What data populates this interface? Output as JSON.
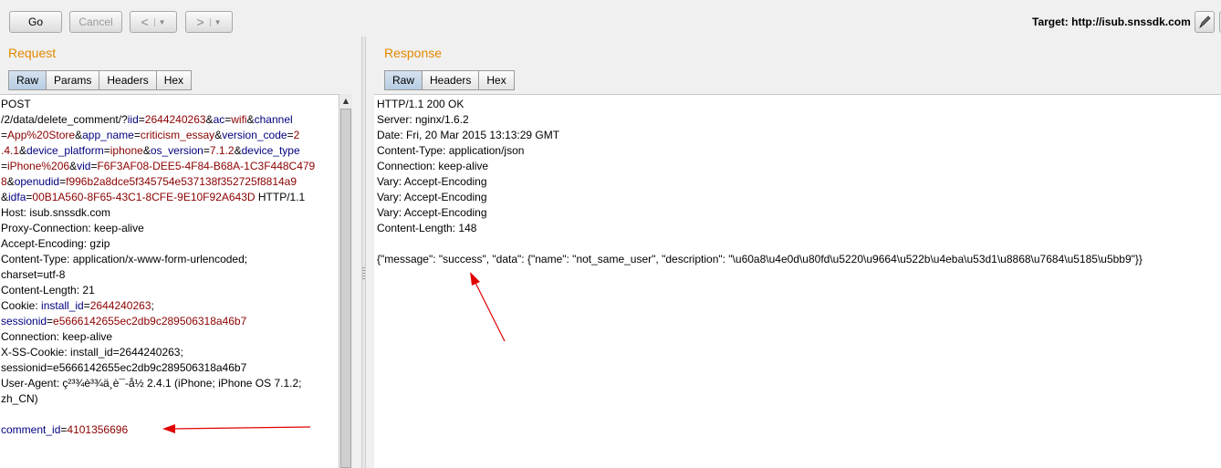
{
  "toolbar": {
    "go_label": "Go",
    "cancel_label": "Cancel",
    "back_glyph": "<",
    "forward_glyph": ">",
    "dropdown_glyph": "▼",
    "target_label": "Target: http://isub.snssdk.com"
  },
  "request": {
    "title": "Request",
    "tabs": [
      "Raw",
      "Params",
      "Headers",
      "Hex"
    ],
    "active_tab": "Raw",
    "lines": [
      [
        [
          "t",
          "POST"
        ]
      ],
      [
        [
          "t",
          "/2/data/delete_comment/?"
        ],
        [
          "k",
          "iid"
        ],
        [
          "t",
          "="
        ],
        [
          "v",
          "2644240263"
        ],
        [
          "t",
          "&"
        ],
        [
          "k",
          "ac"
        ],
        [
          "t",
          "="
        ],
        [
          "v",
          "wifi"
        ],
        [
          "t",
          "&"
        ],
        [
          "k",
          "channel"
        ]
      ],
      [
        [
          "t",
          "="
        ],
        [
          "v",
          "App%20Store"
        ],
        [
          "t",
          "&"
        ],
        [
          "k",
          "app_name"
        ],
        [
          "t",
          "="
        ],
        [
          "v",
          "criticism_essay"
        ],
        [
          "t",
          "&"
        ],
        [
          "k",
          "version_code"
        ],
        [
          "t",
          "="
        ],
        [
          "v",
          "2"
        ]
      ],
      [
        [
          "v",
          ".4.1"
        ],
        [
          "t",
          "&"
        ],
        [
          "k",
          "device_platform"
        ],
        [
          "t",
          "="
        ],
        [
          "v",
          "iphone"
        ],
        [
          "t",
          "&"
        ],
        [
          "k",
          "os_version"
        ],
        [
          "t",
          "="
        ],
        [
          "v",
          "7.1.2"
        ],
        [
          "t",
          "&"
        ],
        [
          "k",
          "device_type"
        ]
      ],
      [
        [
          "t",
          "="
        ],
        [
          "v",
          "iPhone%206"
        ],
        [
          "t",
          "&"
        ],
        [
          "k",
          "vid"
        ],
        [
          "t",
          "="
        ],
        [
          "v",
          "F6F3AF08-DEE5-4F84-B68A-1C3F448C479"
        ]
      ],
      [
        [
          "v",
          "8"
        ],
        [
          "t",
          "&"
        ],
        [
          "k",
          "openudid"
        ],
        [
          "t",
          "="
        ],
        [
          "v",
          "f996b2a8dce5f345754e537138f352725f8814a9"
        ]
      ],
      [
        [
          "t",
          "&"
        ],
        [
          "k",
          "idfa"
        ],
        [
          "t",
          "="
        ],
        [
          "v",
          "00B1A560-8F65-43C1-8CFE-9E10F92A643D"
        ],
        [
          "t",
          " HTTP/1.1"
        ]
      ],
      [
        [
          "t",
          "Host: isub.snssdk.com"
        ]
      ],
      [
        [
          "t",
          "Proxy-Connection: keep-alive"
        ]
      ],
      [
        [
          "t",
          "Accept-Encoding: gzip"
        ]
      ],
      [
        [
          "t",
          "Content-Type: application/x-www-form-urlencoded;"
        ]
      ],
      [
        [
          "t",
          "charset=utf-8"
        ]
      ],
      [
        [
          "t",
          "Content-Length: 21"
        ]
      ],
      [
        [
          "t",
          "Cookie: "
        ],
        [
          "k",
          "install_id"
        ],
        [
          "t",
          "="
        ],
        [
          "v",
          "2644240263"
        ],
        [
          "t",
          ";"
        ]
      ],
      [
        [
          "k",
          "sessionid"
        ],
        [
          "t",
          "="
        ],
        [
          "v",
          "e5666142655ec2db9c289506318a46b7"
        ]
      ],
      [
        [
          "t",
          "Connection: keep-alive"
        ]
      ],
      [
        [
          "t",
          "X-SS-Cookie: install_id=2644240263;"
        ]
      ],
      [
        [
          "t",
          "sessionid=e5666142655ec2db9c289506318a46b7"
        ]
      ],
      [
        [
          "t",
          "User-Agent: ç²³¾è³¾ä¸è¯-å½ 2.4.1 (iPhone; iPhone OS 7.1.2;"
        ]
      ],
      [
        [
          "t",
          "zh_CN)"
        ]
      ],
      [
        [
          "t",
          ""
        ]
      ],
      [
        [
          "k",
          "comment_id"
        ],
        [
          "t",
          "="
        ],
        [
          "v",
          "4101356696"
        ]
      ]
    ]
  },
  "response": {
    "title": "Response",
    "tabs": [
      "Raw",
      "Headers",
      "Hex"
    ],
    "active_tab": "Raw",
    "lines": [
      "HTTP/1.1 200 OK",
      "Server: nginx/1.6.2",
      "Date: Fri, 20 Mar 2015 13:13:29 GMT",
      "Content-Type: application/json",
      "Connection: keep-alive",
      "Vary: Accept-Encoding",
      "Vary: Accept-Encoding",
      "Vary: Accept-Encoding",
      "Content-Length: 148",
      "",
      "{\"message\": \"success\", \"data\": {\"name\": \"not_same_user\", \"description\": \"\\u60a8\\u4e0d\\u80fd\\u5220\\u9664\\u522b\\u4eba\\u53d1\\u8868\\u7684\\u5185\\u5bb9\"}}"
    ]
  },
  "colors": {
    "title_orange": "#e58900",
    "param_name": "#00007f",
    "param_value": "#8b0000",
    "annotation_arrow": "#e00000"
  },
  "icons": {
    "edit": "pencil-icon",
    "scroll_up": "scroll-up-arrow-icon"
  }
}
